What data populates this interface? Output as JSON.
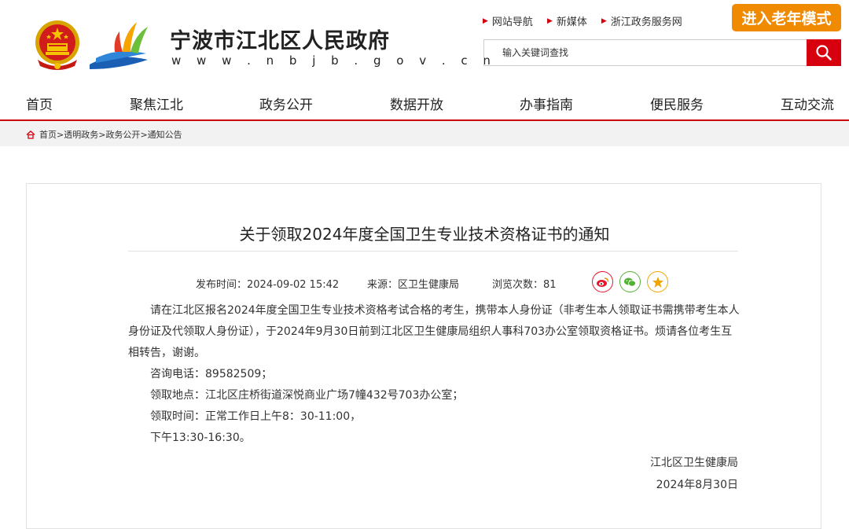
{
  "header": {
    "site_name": "宁波市江北区人民政府",
    "site_url": "w w w . n b j b . g o v . c n",
    "top_links": [
      "网站导航",
      "新媒体",
      "浙江政务服务网"
    ],
    "elder_mode_label": "进入老年模式",
    "search": {
      "placeholder": "输入关键词查找",
      "value": ""
    }
  },
  "nav": [
    "首页",
    "聚焦江北",
    "政务公开",
    "数据开放",
    "办事指南",
    "便民服务",
    "互动交流"
  ],
  "breadcrumb": [
    "首页",
    "透明政务",
    "政务公开",
    "通知公告"
  ],
  "breadcrumb_sep": ">",
  "article": {
    "title": "关于领取2024年度全国卫生专业技术资格证书的通知",
    "meta": {
      "publish_time": "发布时间：2024-09-02 15:42",
      "source": "来源：区卫生健康局",
      "views": "浏览次数：81"
    },
    "paragraphs": [
      "请在江北区报名2024年度全国卫生专业技术资格考试合格的考生，携带本人身份证（非考生本人领取证书需携带考生本人身份证及代领取人身份证），于2024年9月30日前到江北区卫生健康局组织人事科703办公室领取资格证书。烦请各位考生互相转告，谢谢。",
      "咨询电话：89582509；",
      "领取地点：江北区庄桥街道深悦商业广场7幢432号703办公室；",
      "领取时间：正常工作日上午8：30-11:00，",
      "下午13:30-16:30。"
    ],
    "signature": "江北区卫生健康局",
    "date": "2024年8月30日"
  },
  "colors": {
    "brand_red": "#d6000f",
    "elder_orange": "#f08a00",
    "weibo": "#e6162d",
    "wechat": "#52b035",
    "favorite": "#f0a500"
  },
  "share_icons": [
    "weibo-icon",
    "wechat-icon",
    "star-icon"
  ]
}
